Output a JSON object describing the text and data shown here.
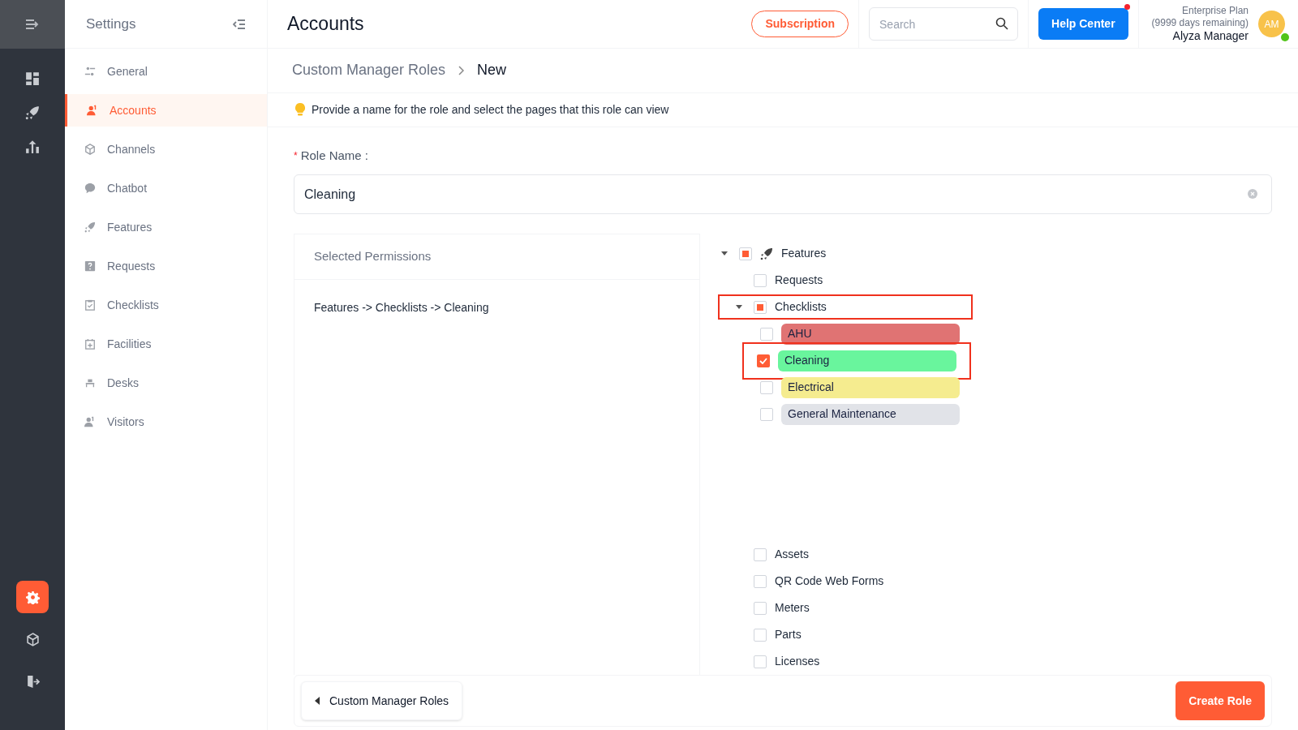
{
  "rail": {
    "bottom_items": [
      {
        "selected": true
      },
      {
        "selected": false
      },
      {
        "selected": false
      }
    ]
  },
  "sidebar": {
    "title": "Settings",
    "items": [
      {
        "label": "General",
        "selected": false
      },
      {
        "label": "Accounts",
        "selected": true
      },
      {
        "label": "Channels",
        "selected": false
      },
      {
        "label": "Chatbot",
        "selected": false
      },
      {
        "label": "Features",
        "selected": false
      },
      {
        "label": "Requests",
        "selected": false
      },
      {
        "label": "Checklists",
        "selected": false
      },
      {
        "label": "Facilities",
        "selected": false
      },
      {
        "label": "Desks",
        "selected": false
      },
      {
        "label": "Visitors",
        "selected": false
      }
    ]
  },
  "header": {
    "title": "Accounts",
    "subscription": "Subscription",
    "search_placeholder": "Search",
    "help": "Help Center",
    "help_notification": true,
    "plan": "Enterprise Plan",
    "plan_days": "(9999 days remaining)",
    "user": "Alyza Manager",
    "avatar": "AM",
    "online": true
  },
  "breadcrumb": [
    "Custom Manager Roles",
    "New"
  ],
  "tip": "Provide a name for the role and select the pages that this role can view",
  "form": {
    "required_mark": "*",
    "label": "Role Name :",
    "value": "Cleaning"
  },
  "selected_permissions": {
    "title": "Selected Permissions",
    "items": [
      "Features -> Checklists -> Cleaning"
    ]
  },
  "tree": [
    {
      "label": "Features",
      "checked": false,
      "indeterminate": true,
      "expanded": true,
      "highlighted": false,
      "children": [
        {
          "label": "Requests",
          "checked": false,
          "indeterminate": false,
          "highlighted": false
        },
        {
          "label": "Checklists",
          "checked": false,
          "indeterminate": true,
          "expanded": true,
          "highlighted": true,
          "children": [
            {
              "label": "AHU",
              "color": "#e07373",
              "checked": false,
              "highlighted": false
            },
            {
              "label": "Cleaning",
              "color": "#69f59d",
              "checked": true,
              "highlighted": true
            },
            {
              "label": "Electrical",
              "color": "#f5ec8f",
              "checked": false,
              "highlighted": false
            },
            {
              "label": "General Maintenance",
              "color": "#e1e3e8",
              "checked": false,
              "highlighted": false
            }
          ]
        },
        {
          "label": "Assets",
          "checked": false,
          "indeterminate": false,
          "highlighted": false
        },
        {
          "label": "QR Code Web Forms",
          "checked": false,
          "indeterminate": false,
          "highlighted": false
        },
        {
          "label": "Meters",
          "checked": false,
          "indeterminate": false,
          "highlighted": false
        },
        {
          "label": "Parts",
          "checked": false,
          "indeterminate": false,
          "highlighted": false
        },
        {
          "label": "Licenses",
          "checked": false,
          "indeterminate": false,
          "highlighted": false
        }
      ]
    }
  ],
  "footer": {
    "back": "Custom Manager Roles",
    "create": "Create Role"
  }
}
